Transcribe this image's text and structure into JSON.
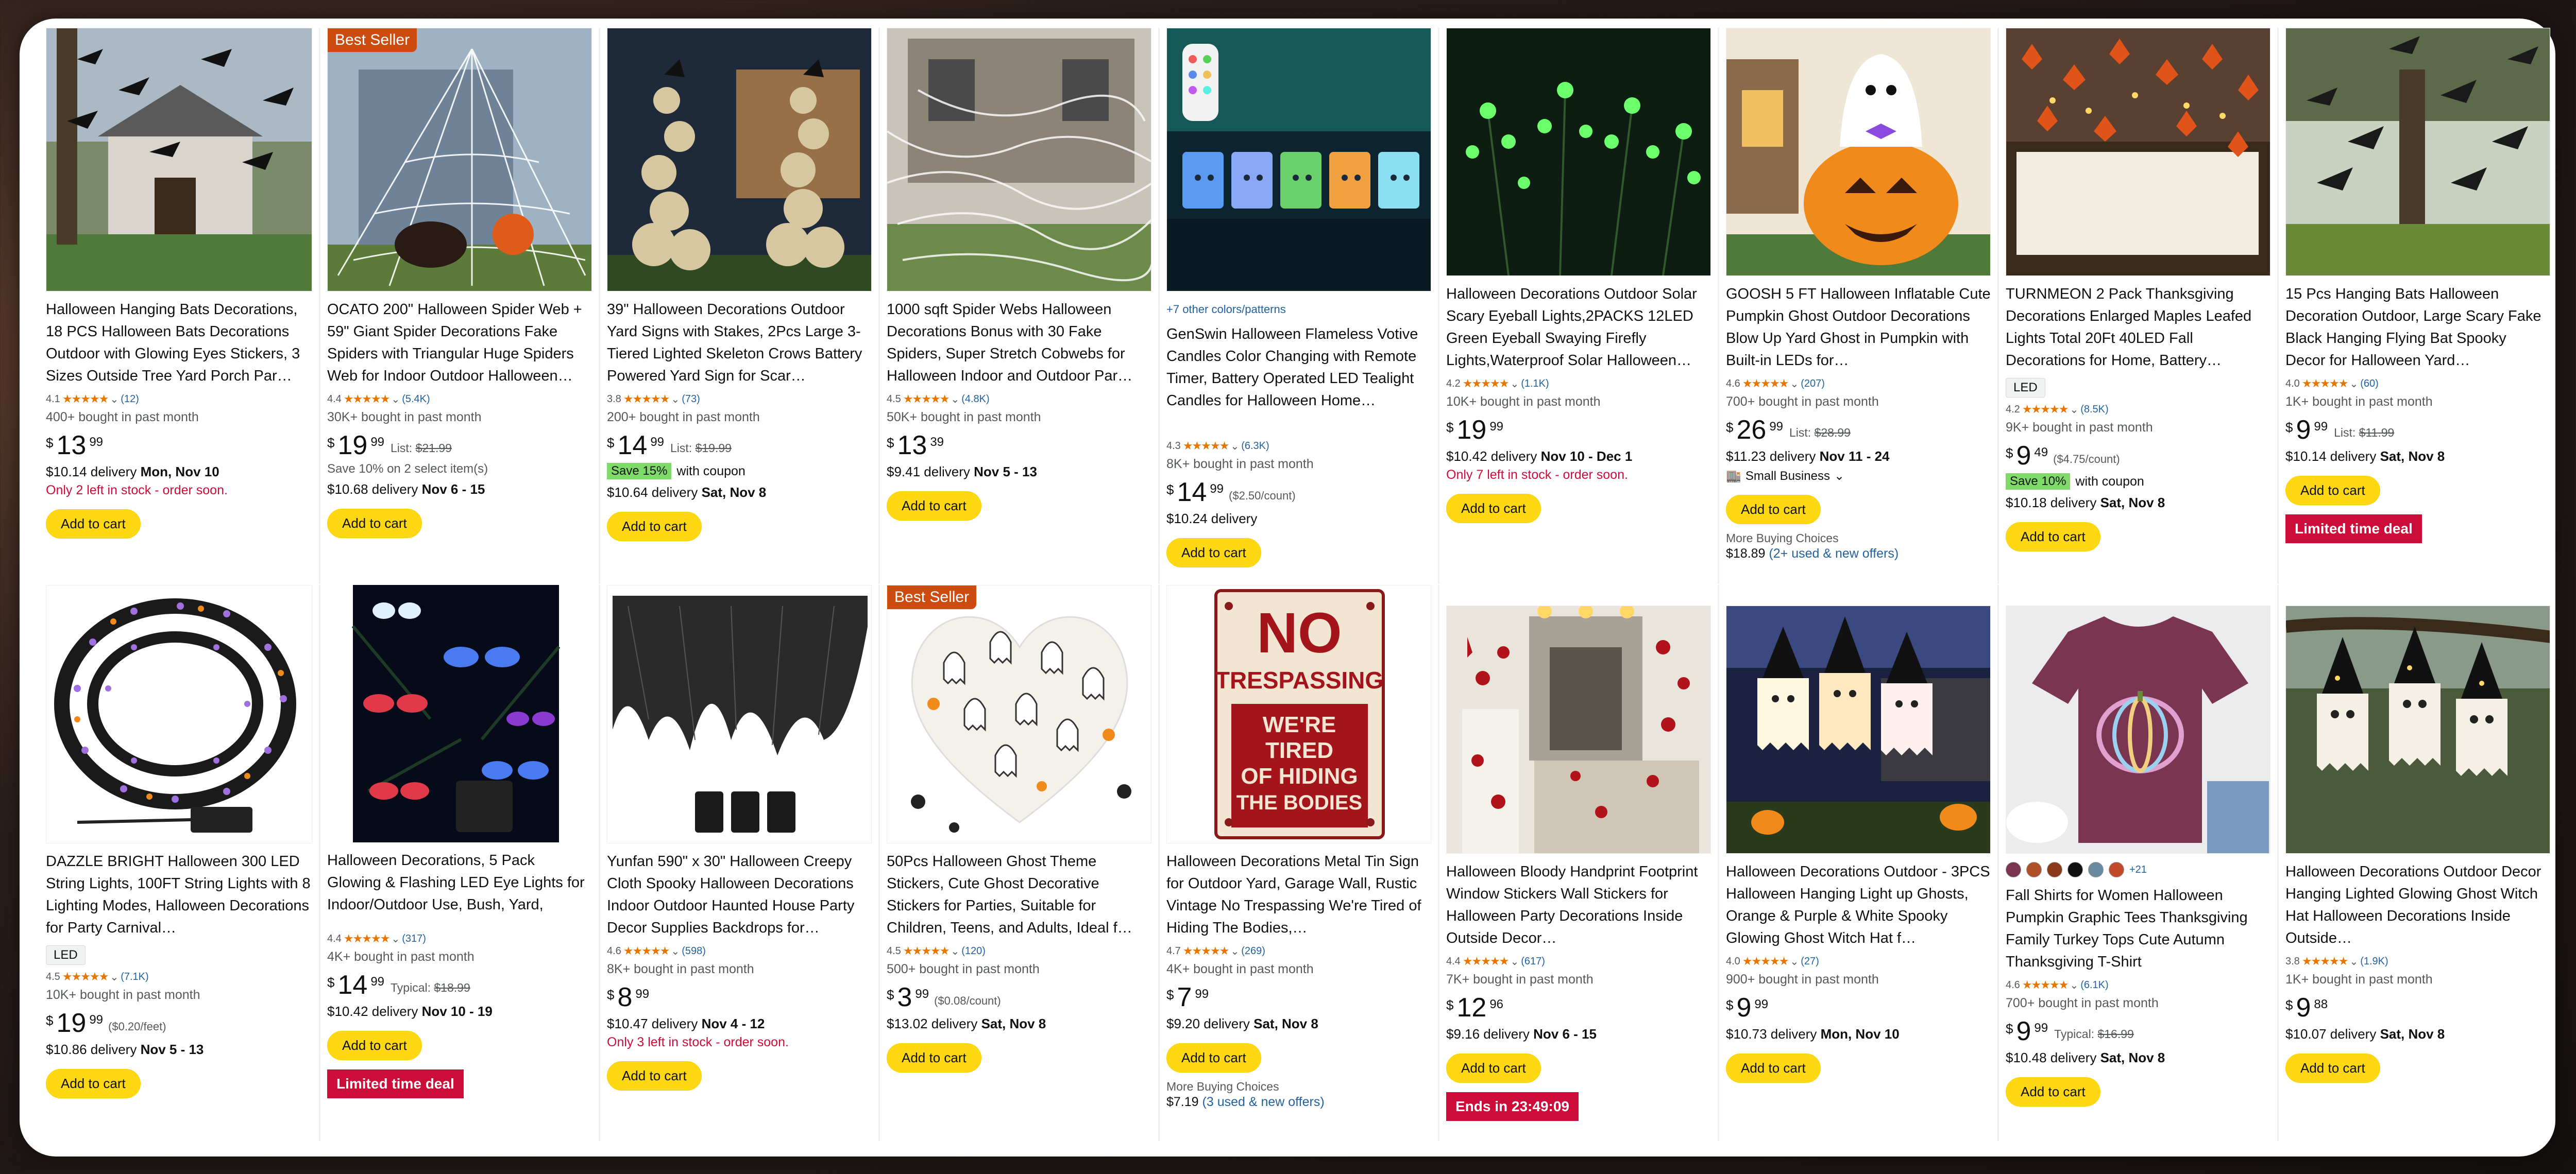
{
  "row1": [
    {
      "title": "Halloween Hanging Bats Decorations, 18 PCS Halloween Bats Decorations Outdoor with Glowing Eyes Stickers, 3 Sizes Outside Tree Yard Porch Par…",
      "rating": "4.1",
      "reviews": "(12)",
      "bought": "400+ bought in past month",
      "price_whole": "13",
      "price_frac": "99",
      "delivery_prefix": "$10.14 delivery ",
      "delivery_date": "Mon, Nov 10",
      "stock": "Only 2 left in stock - order soon.",
      "atc": "Add to cart"
    },
    {
      "badge": "Best Seller",
      "title": "OCATO 200\" Halloween Spider Web + 59\" Giant Spider Decorations Fake Spiders with Triangular Huge Spiders Web for Indoor Outdoor Halloween…",
      "rating": "4.4",
      "reviews": "(5.4K)",
      "bought": "30K+ bought in past month",
      "price_whole": "19",
      "price_frac": "99",
      "list_label": "List: ",
      "list_price": "$21.99",
      "save": "Save 10% on 2 select item(s)",
      "delivery_prefix": "$10.68 delivery ",
      "delivery_date": "Nov 6 - 15",
      "atc": "Add to cart"
    },
    {
      "title": "39\" Halloween Decorations Outdoor Yard Signs with Stakes, 2Pcs Large 3-Tiered Lighted Skeleton Crows Battery Powered Yard Sign for Scar…",
      "rating": "3.8",
      "reviews": "(73)",
      "bought": "200+ bought in past month",
      "price_whole": "14",
      "price_frac": "99",
      "list_label": "List: ",
      "list_price": "$19.99",
      "coupon_badge": "Save 15%",
      "coupon_text": "with coupon",
      "delivery_prefix": "$10.64 delivery ",
      "delivery_date": "Sat, Nov 8",
      "atc": "Add to cart"
    },
    {
      "title": "1000 sqft Spider Webs Halloween Decorations Bonus with 30 Fake Spiders, Super Stretch Cobwebs for Halloween Indoor and Outdoor Par…",
      "rating": "4.5",
      "reviews": "(4.8K)",
      "bought": "50K+ bought in past month",
      "price_whole": "13",
      "price_frac": "39",
      "delivery_prefix": "$9.41 delivery ",
      "delivery_date": "Nov 5 - 13",
      "atc": "Add to cart"
    },
    {
      "colors_link": "+7 other colors/patterns",
      "title": "GenSwin Halloween Flameless Votive Candles Color Changing with Remote Timer, Battery Operated LED Tealight Candles for Halloween Home…",
      "rating": "4.3",
      "reviews": "(6.3K)",
      "bought": "8K+ bought in past month",
      "price_whole": "14",
      "price_frac": "99",
      "unit": "($2.50/count)",
      "delivery_prefix": "$10.24 delivery",
      "delivery_date": "",
      "atc": "Add to cart"
    },
    {
      "title": "Halloween Decorations Outdoor Solar Scary Eyeball Lights,2PACKS 12LED Green Eyeball Swaying Firefly Lights,Waterproof Solar Halloween…",
      "rating": "4.2",
      "reviews": "(1.1K)",
      "bought": "10K+ bought in past month",
      "price_whole": "19",
      "price_frac": "99",
      "delivery_prefix": "$10.42 delivery ",
      "delivery_date": "Nov 10 - Dec 1",
      "stock": "Only 7 left in stock - order soon.",
      "atc": "Add to cart"
    },
    {
      "title": "GOOSH 5 FT Halloween Inflatable Cute Pumpkin Ghost Outdoor Decorations Blow Up Yard Ghost in Pumpkin with Built-in LEDs for…",
      "rating": "4.6",
      "reviews": "(207)",
      "bought": "700+ bought in past month",
      "price_whole": "26",
      "price_frac": "99",
      "list_label": "List: ",
      "list_price": "$28.99",
      "delivery_prefix": "$11.23 delivery ",
      "delivery_date": "Nov 11 - 24",
      "small_business": "Small Business",
      "atc": "Add to cart",
      "more_label": "More Buying Choices",
      "more_price": "$18.89",
      "more_link": "(2+ used & new offers)"
    },
    {
      "title": "TURNMEON 2 Pack Thanksgiving Decorations Enlarged Maples Leafed Lights Total 20Ft 40LED Fall Decorations for Home, Battery…",
      "chip": "LED",
      "rating": "4.2",
      "reviews": "(8.5K)",
      "bought": "9K+ bought in past month",
      "price_whole": "9",
      "price_frac": "49",
      "unit": "($4.75/count)",
      "coupon_badge": "Save 10%",
      "coupon_text": "with coupon",
      "delivery_prefix": "$10.18 delivery ",
      "delivery_date": "Sat, Nov 8",
      "atc": "Add to cart"
    },
    {
      "title": "15 Pcs Hanging Bats Halloween Decoration Outdoor, Large Scary Fake Black Hanging Flying Bat Spooky Decor for Halloween Yard…",
      "rating": "4.0",
      "reviews": "(60)",
      "bought": "1K+ bought in past month",
      "price_whole": "9",
      "price_frac": "99",
      "list_label": "List: ",
      "list_price": "$11.99",
      "delivery_prefix": "$10.14 delivery ",
      "delivery_date": "Sat, Nov 8",
      "atc": "Add to cart",
      "deal": "Limited time deal"
    }
  ],
  "row2": [
    {
      "title": "DAZZLE BRIGHT Halloween 300 LED String Lights, 100FT String Lights with 8 Lighting Modes, Halloween Decorations for Party Carnival…",
      "chip": "LED",
      "rating": "4.5",
      "reviews": "(7.1K)",
      "bought": "10K+ bought in past month",
      "price_whole": "19",
      "price_frac": "99",
      "unit": "($0.20/feet)",
      "delivery_prefix": "$10.86 delivery ",
      "delivery_date": "Nov 5 - 13",
      "atc": "Add to cart"
    },
    {
      "title": "Halloween Decorations, 5 Pack Glowing & Flashing LED Eye Lights for Indoor/Outdoor Use, Bush, Yard, Window, Party",
      "rating": "4.4",
      "reviews": "(317)",
      "bought": "4K+ bought in past month",
      "price_whole": "14",
      "price_frac": "99",
      "list_label": "Typical: ",
      "list_price": "$18.99",
      "delivery_prefix": "$10.42 delivery ",
      "delivery_date": "Nov 10 - 19",
      "atc": "Add to cart",
      "deal": "Limited time deal"
    },
    {
      "title": "Yunfan 590\" x 30\" Halloween Creepy Cloth Spooky Halloween Decorations Indoor Outdoor Haunted House Party Decor Supplies Backdrops for…",
      "rating": "4.6",
      "reviews": "(598)",
      "bought": "8K+ bought in past month",
      "price_whole": "8",
      "price_frac": "99",
      "delivery_prefix": "$10.47 delivery ",
      "delivery_date": "Nov 4 - 12",
      "stock": "Only 3 left in stock - order soon.",
      "atc": "Add to cart"
    },
    {
      "badge": "Best Seller",
      "title": "50Pcs Halloween Ghost Theme Stickers, Cute Ghost Decorative Stickers for Parties, Suitable for Children, Teens, and Adults, Ideal f…",
      "rating": "4.5",
      "reviews": "(120)",
      "bought": "500+ bought in past month",
      "price_whole": "3",
      "price_frac": "99",
      "unit": "($0.08/count)",
      "delivery_prefix": "$13.02 delivery ",
      "delivery_date": "Sat, Nov 8",
      "atc": "Add to cart"
    },
    {
      "sign_no": "NO",
      "sign_trespassing": "TRESPASSING",
      "sign_line1": "WE'RE",
      "sign_line2": "TIRED",
      "sign_line3": "OF HIDING",
      "sign_line4": "THE BODIES",
      "title": "Halloween Decorations Metal Tin Sign for Outdoor Yard, Garage Wall, Rustic Vintage No Trespassing We're Tired of Hiding The Bodies,…",
      "rating": "4.7",
      "reviews": "(269)",
      "bought": "4K+ bought in past month",
      "price_whole": "7",
      "price_frac": "99",
      "delivery_prefix": "$9.20 delivery ",
      "delivery_date": "Sat, Nov 8",
      "atc": "Add to cart",
      "more_label": "More Buying Choices",
      "more_price": "$7.19",
      "more_link": "(3 used & new offers)"
    },
    {
      "title": "Halloween Bloody Handprint Footprint Window Stickers Wall Stickers for Halloween Party Decorations Inside Outside Decor…",
      "rating": "4.4",
      "reviews": "(617)",
      "bought": "7K+ bought in past month",
      "price_whole": "12",
      "price_frac": "96",
      "delivery_prefix": "$9.16 delivery ",
      "delivery_date": "Nov 6 - 15",
      "atc": "Add to cart",
      "deal": "Ends in 23:49:09"
    },
    {
      "title": "Halloween Decorations Outdoor - 3PCS Halloween Hanging Light up Ghosts, Orange & Purple & White Spooky Glowing Ghost Witch Hat f…",
      "rating": "4.0",
      "reviews": "(27)",
      "bought": "900+ bought in past month",
      "price_whole": "9",
      "price_frac": "99",
      "delivery_prefix": "$10.73 delivery ",
      "delivery_date": "Mon, Nov 10",
      "atc": "Add to cart"
    },
    {
      "swatch_more": "+21",
      "title": "Fall Shirts for Women Halloween Pumpkin Graphic Tees Thanksgiving Family Turkey Tops Cute Autumn Thanksgiving T-Shirt",
      "rating": "4.6",
      "reviews": "(6.1K)",
      "bought": "700+ bought in past month",
      "price_whole": "9",
      "price_frac": "99",
      "list_label": "Typical: ",
      "list_price": "$16.99",
      "delivery_prefix": "$10.48 delivery ",
      "delivery_date": "Sat, Nov 8",
      "atc": "Add to cart"
    },
    {
      "title": "Halloween Decorations Outdoor Decor Hanging Lighted Glowing Ghost Witch Hat Halloween Decorations Inside Outside…",
      "rating": "3.8",
      "reviews": "(1.9K)",
      "bought": "1K+ bought in past month",
      "price_whole": "9",
      "price_frac": "88",
      "delivery_prefix": "$10.07 delivery ",
      "delivery_date": "Sat, Nov 8",
      "atc": "Add to cart"
    }
  ],
  "currency": "$",
  "stars_glyph": "★★★★★",
  "colors": {
    "atc": "#ffd814",
    "deal": "#cc0c39",
    "coupon": "#7fda69",
    "best_seller": "#cc4b0e",
    "link": "#2162a1"
  }
}
